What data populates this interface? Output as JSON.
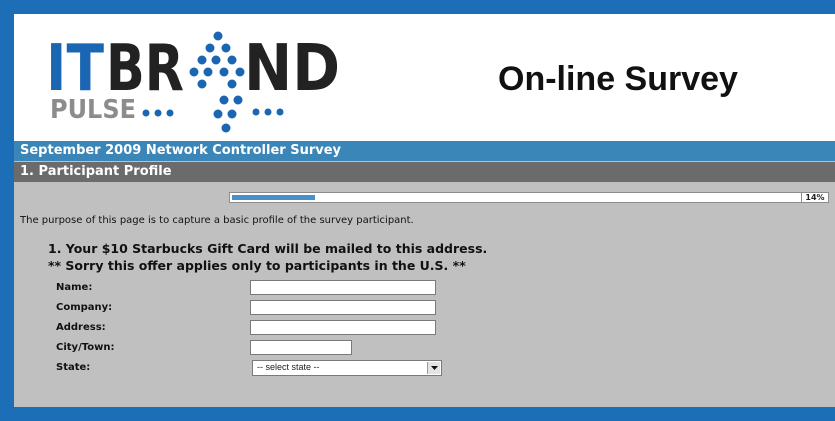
{
  "header": {
    "logo": {
      "line1_part1": "IT",
      "line1_part2": "BR",
      "line1_part3": "ND",
      "line2": "PULSE"
    },
    "title": "On-line Survey"
  },
  "survey": {
    "title": "September 2009 Network Controller Survey",
    "section": "1. Participant Profile",
    "progress": {
      "percent": 14,
      "label": "14%"
    },
    "intro": "The purpose of this page is to capture a basic profile of the survey participant.",
    "question": {
      "line1": "1. Your $10 Starbucks Gift Card will be mailed to this address.",
      "line2": "** Sorry this offer applies only to participants in the U.S. **"
    },
    "fields": {
      "name": {
        "label": "Name:",
        "value": ""
      },
      "company": {
        "label": "Company:",
        "value": ""
      },
      "address": {
        "label": "Address:",
        "value": ""
      },
      "city": {
        "label": "City/Town:",
        "value": ""
      },
      "state": {
        "label": "State:",
        "selected": "-- select state --"
      }
    }
  },
  "colors": {
    "frame": "#1c6fb7",
    "survey_bar": "#3a86b9",
    "section_bar": "#6b6b6b",
    "body": "#c0c0c0",
    "progress_fill": "#4a90c8",
    "logo_blue": "#1a66b3",
    "logo_gray": "#8c8c8c"
  }
}
